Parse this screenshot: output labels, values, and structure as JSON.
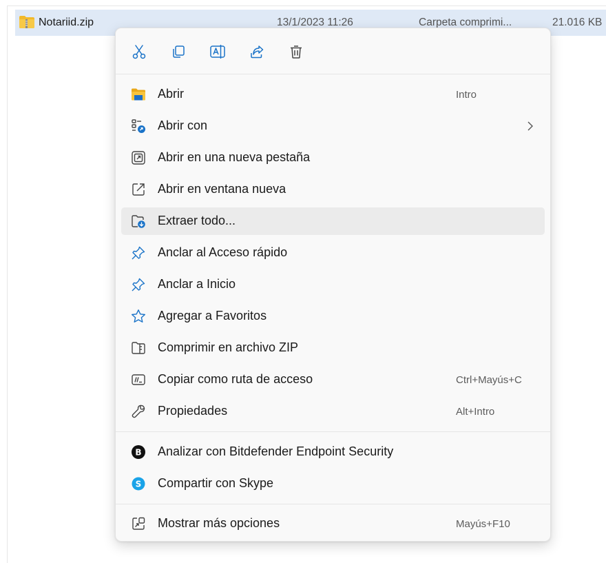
{
  "file_row": {
    "name": "Notariid.zip",
    "date": "13/1/2023 11:26",
    "type": "Carpeta comprimi...",
    "size": "21.016 KB",
    "icon": "zip-folder-icon"
  },
  "toolbar": [
    {
      "name": "cut",
      "icon": "scissors-icon"
    },
    {
      "name": "copy",
      "icon": "copy-icon"
    },
    {
      "name": "rename",
      "icon": "rename-icon"
    },
    {
      "name": "share",
      "icon": "share-icon"
    },
    {
      "name": "delete",
      "icon": "trash-icon"
    }
  ],
  "menu": {
    "items": [
      {
        "label": "Abrir",
        "shortcut": "Intro",
        "icon": "folder-open-icon"
      },
      {
        "label": "Abrir con",
        "shortcut": "",
        "icon": "open-with-icon",
        "submenu": true
      },
      {
        "label": "Abrir en una nueva pestaña",
        "shortcut": "",
        "icon": "new-tab-icon"
      },
      {
        "label": "Abrir en ventana nueva",
        "shortcut": "",
        "icon": "new-window-icon"
      },
      {
        "label": "Extraer todo...",
        "shortcut": "",
        "icon": "extract-icon",
        "highlighted": true
      },
      {
        "label": "Anclar al Acceso rápido",
        "shortcut": "",
        "icon": "pin-icon"
      },
      {
        "label": "Anclar a Inicio",
        "shortcut": "",
        "icon": "pin-icon"
      },
      {
        "label": "Agregar a Favoritos",
        "shortcut": "",
        "icon": "star-icon"
      },
      {
        "label": "Comprimir en archivo ZIP",
        "shortcut": "",
        "icon": "zip-icon"
      },
      {
        "label": "Copiar como ruta de acceso",
        "shortcut": "Ctrl+Mayús+C",
        "icon": "copy-path-icon"
      },
      {
        "label": "Propiedades",
        "shortcut": "Alt+Intro",
        "icon": "wrench-icon"
      }
    ],
    "apps": [
      {
        "label": "Analizar con Bitdefender Endpoint Security",
        "icon": "bitdefender-icon"
      },
      {
        "label": "Compartir con Skype",
        "icon": "skype-icon"
      }
    ],
    "more": {
      "label": "Mostrar más opciones",
      "shortcut": "Mayús+F10",
      "icon": "more-options-icon"
    }
  },
  "colors": {
    "accent": "#1a73c8",
    "selection": "#dfe9f6",
    "hover": "#ebebeb",
    "folder": "#f2b92b"
  }
}
